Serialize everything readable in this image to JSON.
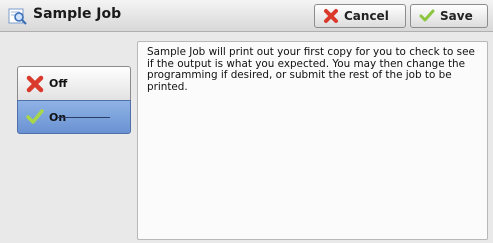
{
  "header": {
    "title": "Sample Job",
    "title_icon": "magnifier-icon",
    "cancel_label": "Cancel",
    "save_label": "Save"
  },
  "options": {
    "off_label": "Off",
    "on_label": "On",
    "selected": "On"
  },
  "description": "Sample Job will print out your first copy for you to check to see if the output is what you expected.  You may then change the programming if desired, or submit the rest of the job to be printed.",
  "colors": {
    "selected_option": "#7ea3dc",
    "cancel_icon": "#d93a2b",
    "check_icon": "#8cc63f"
  }
}
